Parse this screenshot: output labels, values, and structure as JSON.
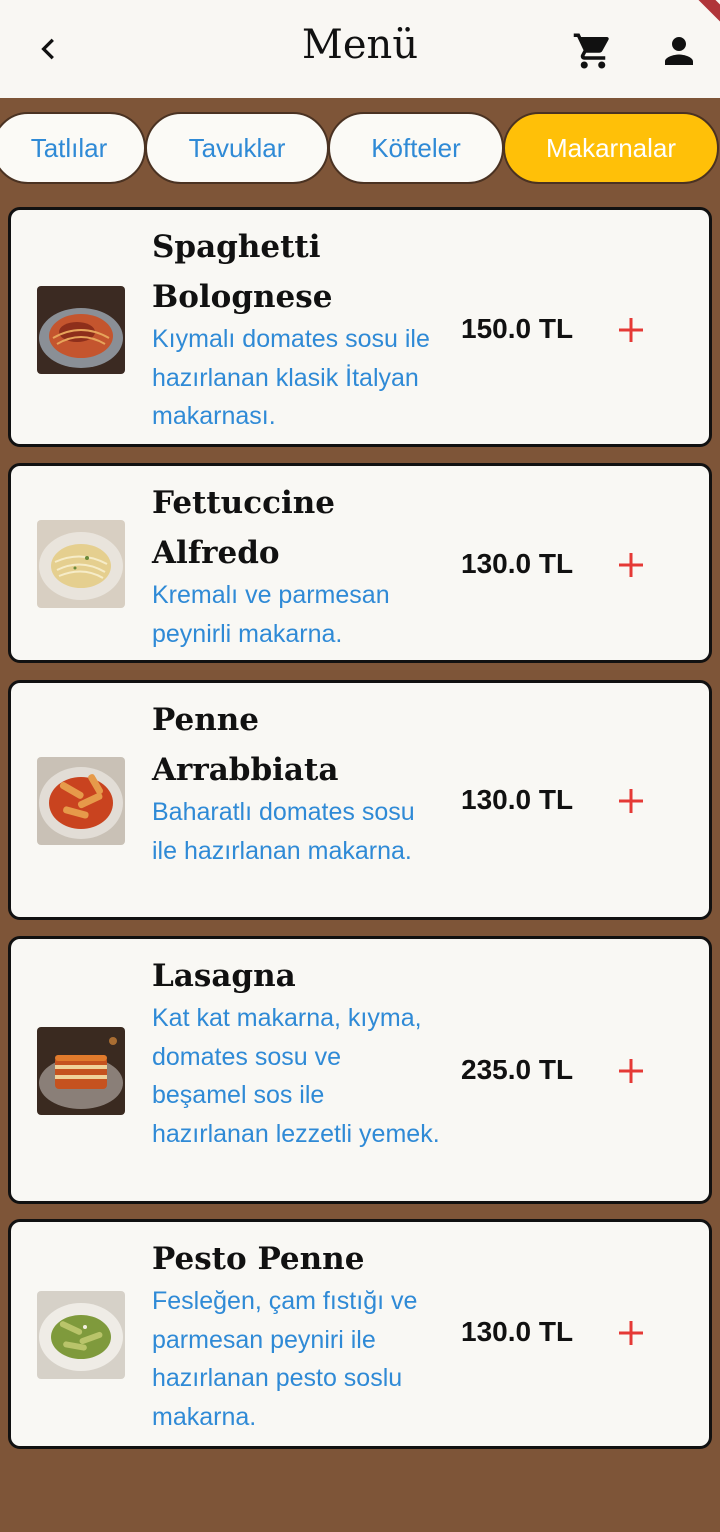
{
  "header": {
    "title": "Menü"
  },
  "tabs": [
    {
      "label": "Tatlılar",
      "active": false
    },
    {
      "label": "Tavuklar",
      "active": false
    },
    {
      "label": "Köfteler",
      "active": false
    },
    {
      "label": "Makarnalar",
      "active": true
    }
  ],
  "items": [
    {
      "name": "Spaghetti Bolognese",
      "description": "Kıymalı domates sosu ile hazırlanan klasik İtalyan makarnası.",
      "price": "150.0 TL"
    },
    {
      "name": "Fettuccine Alfredo",
      "description": "Kremalı ve parmesan peynirli makarna.",
      "price": "130.0 TL"
    },
    {
      "name": "Penne Arrabbiata",
      "description": "Baharatlı domates sosu ile hazırlanan makarna.",
      "price": "130.0 TL"
    },
    {
      "name": "Lasagna",
      "description": "Kat kat makarna, kıyma, domates sosu ve beşamel sos ile hazırlanan lezzetli yemek.",
      "price": "235.0 TL"
    },
    {
      "name": "Pesto Penne",
      "description": "Fesleğen, çam fıstığı ve parmesan peyniri ile hazırlanan pesto soslu makarna.",
      "price": "130.0 TL"
    }
  ],
  "icons": {
    "back": "chevron-left-icon",
    "cart": "cart-icon",
    "user": "user-icon",
    "add": "plus-icon"
  },
  "colors": {
    "background": "#7e5538",
    "accent": "#ffc008",
    "link_text": "#2f8ad6",
    "add": "#e53935"
  }
}
